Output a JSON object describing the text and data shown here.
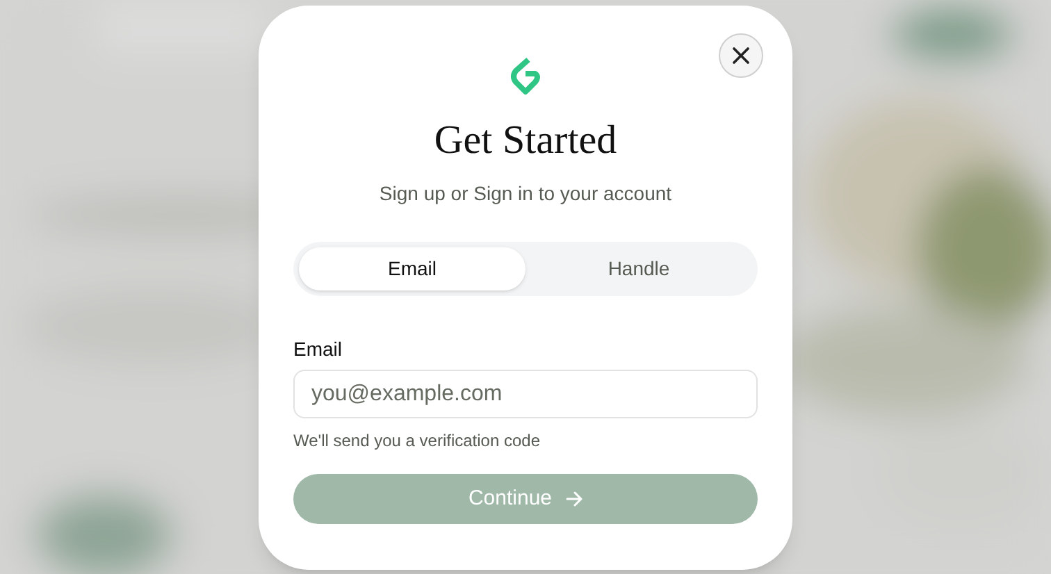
{
  "dialog": {
    "title": "Get Started",
    "subtitle": "Sign up or Sign in to your account",
    "tabs": [
      {
        "label": "Email",
        "selected": true
      },
      {
        "label": "Handle",
        "selected": false
      }
    ],
    "field": {
      "label": "Email",
      "placeholder": "you@example.com",
      "hint": "We'll send you a verification code"
    },
    "button": {
      "label": "Continue",
      "disabled": true
    }
  }
}
